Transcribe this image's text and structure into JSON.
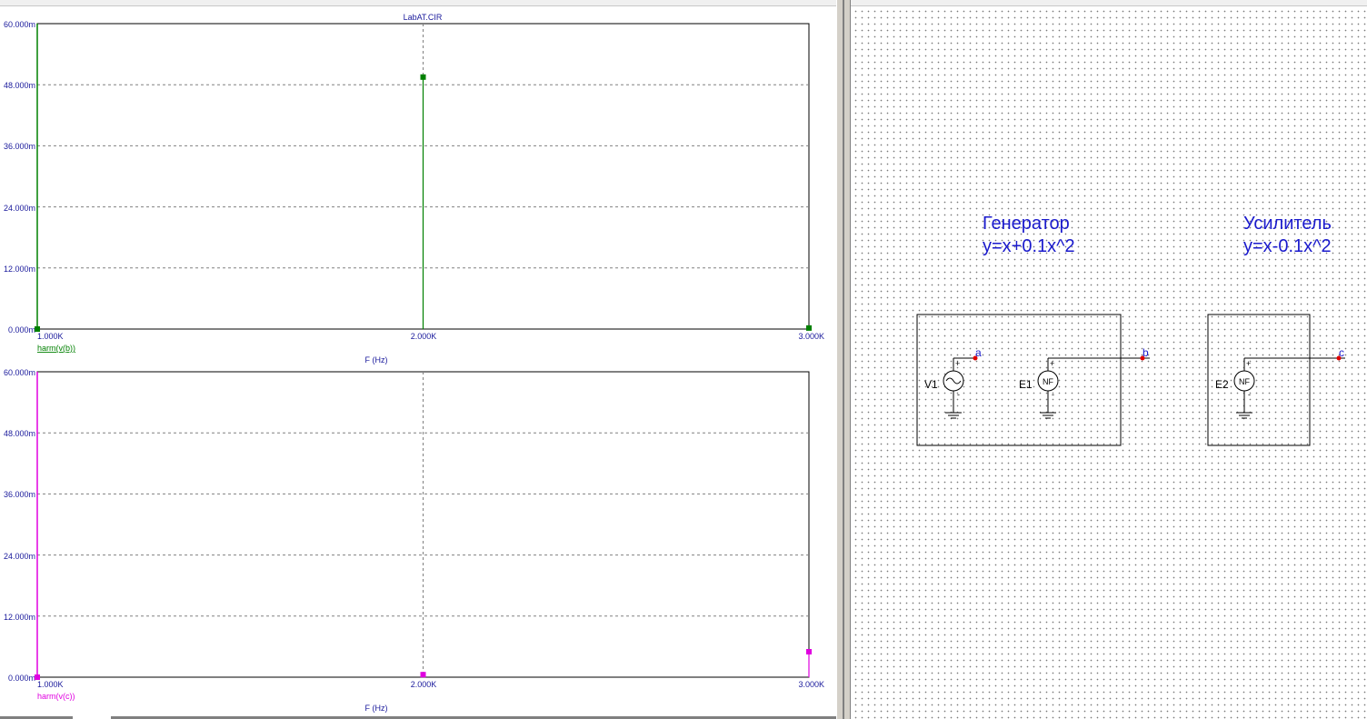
{
  "plot": {
    "title": "LabAT.CIR",
    "panels": [
      {
        "trace_name": "harm(v(b))",
        "trace_color": "#008000",
        "y_ticks": [
          "60.000m",
          "48.000m",
          "36.000m",
          "24.000m",
          "12.000m",
          "0.000m"
        ],
        "x_ticks": [
          "1.000K",
          "2.000K",
          "3.000K"
        ],
        "x_label": "F (Hz)"
      },
      {
        "trace_name": "harm(v(c))",
        "trace_color": "#e000e0",
        "y_ticks": [
          "60.000m",
          "48.000m",
          "36.000m",
          "24.000m",
          "12.000m",
          "0.000m"
        ],
        "x_ticks": [
          "1.000K",
          "2.000K",
          "3.000K"
        ],
        "x_label": "F (Hz)"
      }
    ]
  },
  "chart_data": [
    {
      "type": "bar",
      "title": "LabAT.CIR",
      "xlabel": "F (Hz)",
      "ylabel": "",
      "xlim": [
        1000,
        3000
      ],
      "ylim": [
        0,
        0.06
      ],
      "grid": true,
      "series": [
        {
          "name": "harm(v(b))",
          "x": [
            1000,
            2000,
            3000
          ],
          "values": [
            0.0,
            0.0495,
            0.0002
          ]
        }
      ]
    },
    {
      "type": "bar",
      "title": "",
      "xlabel": "F (Hz)",
      "ylabel": "",
      "xlim": [
        1000,
        3000
      ],
      "ylim": [
        0,
        0.06
      ],
      "grid": true,
      "series": [
        {
          "name": "harm(v(c))",
          "x": [
            1000,
            2000,
            3000
          ],
          "values": [
            0.0,
            0.0005,
            0.005
          ]
        }
      ]
    }
  ],
  "schematic": {
    "generator": {
      "title": "Генератор",
      "formula": "y=x+0.1x^2"
    },
    "amplifier": {
      "title": "Усилитель",
      "formula": "y=x-0.1x^2"
    },
    "components": {
      "v1": {
        "label": "V1",
        "plus": "+",
        "minus": "-"
      },
      "e1": {
        "label": "E1",
        "symbol": "NF",
        "plus": "+",
        "minus": "-"
      },
      "e2": {
        "label": "E2",
        "symbol": "NF",
        "plus": "+",
        "minus": "-"
      }
    },
    "nodes": {
      "a": "a",
      "b": "b",
      "c": "c"
    },
    "colors": {
      "text": "#1a1acc",
      "wire": "#000000",
      "node": "#e00000"
    }
  }
}
